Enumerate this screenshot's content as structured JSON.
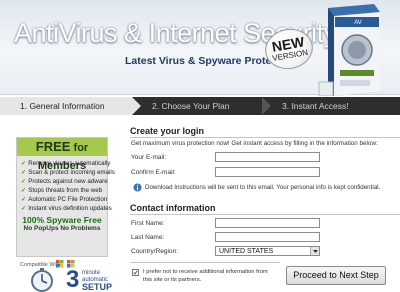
{
  "header": {
    "title": "AntiVirus & Internet Security",
    "subtitle": "Latest Virus & Spyware Protection",
    "badge_line1": "NEW",
    "badge_line2": "VERSION"
  },
  "steps": [
    {
      "label": "1. General Information",
      "active": true
    },
    {
      "label": "2. Choose Your Plan",
      "active": false
    },
    {
      "label": "3. Instant Access!",
      "active": false
    }
  ],
  "promo": {
    "head_big": "FREE",
    "head_small": " for Members",
    "features": [
      "Remove viruses automatically",
      "Scan & protect incoming emails",
      "Protects against new adware",
      "Stops threats from the web",
      "Automatic PC File Protection",
      "Instant virus definition updates"
    ],
    "free_line": "100% Spyware Free",
    "nopop_line": "No PopUps No Problems",
    "compat_label": "Compatible With",
    "setup_num": "3",
    "setup_mini1": "minute",
    "setup_mini2": "automatic",
    "setup_word": "SETUP"
  },
  "login": {
    "title": "Create your login",
    "intro": "Get maximum virus protection now! Get instant access by filling in the information below:",
    "email_label": "Your E-mail:",
    "confirm_label": "Confirm E-mail:",
    "note": "Download Instructions will be sent to this email. Your personal info is kept confidential."
  },
  "contact": {
    "title": "Contact information",
    "first_label": "First Name:",
    "last_label": "Last Name:",
    "country_label": "Country/Region:",
    "country_value": "UNITED STATES"
  },
  "optout": {
    "text": "I prefer not to receive additional information from this site or its partners.",
    "checked": true
  },
  "cta": {
    "label": "Proceed to Next Step"
  }
}
